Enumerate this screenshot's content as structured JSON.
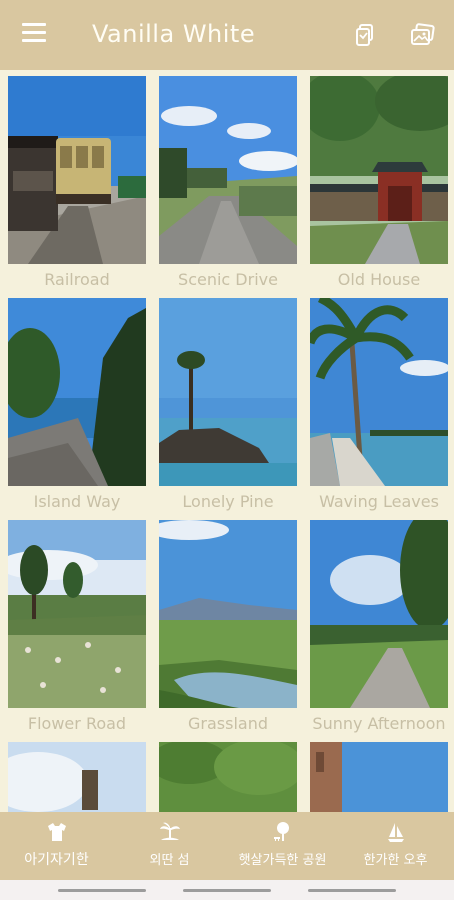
{
  "app": {
    "title": "Vanilla White"
  },
  "header": {
    "menu_icon": "hamburger-menu-icon",
    "actions": [
      {
        "icon": "copy-icon"
      },
      {
        "icon": "gallery-icon"
      }
    ]
  },
  "gallery": {
    "items": [
      {
        "label": "Railroad"
      },
      {
        "label": "Scenic Drive"
      },
      {
        "label": "Old House"
      },
      {
        "label": "Island Way"
      },
      {
        "label": "Lonely Pine"
      },
      {
        "label": "Waving Leaves"
      },
      {
        "label": "Flower Road"
      },
      {
        "label": "Grassland"
      },
      {
        "label": "Sunny Afternoon"
      }
    ]
  },
  "bottom_nav": {
    "items": [
      {
        "label": "아기자기한",
        "icon": "clothes-icon",
        "active": true
      },
      {
        "label": "외딴 섬",
        "icon": "island-icon",
        "active": false
      },
      {
        "label": "햇살가득한 공원",
        "icon": "park-tree-icon",
        "active": false
      },
      {
        "label": "한가한 오후",
        "icon": "sailboat-icon",
        "active": false
      }
    ]
  },
  "colors": {
    "bar": "#d9c7a0",
    "background": "#f5f1dc",
    "caption": "#c7bfa5",
    "text_light": "#ffffff"
  }
}
